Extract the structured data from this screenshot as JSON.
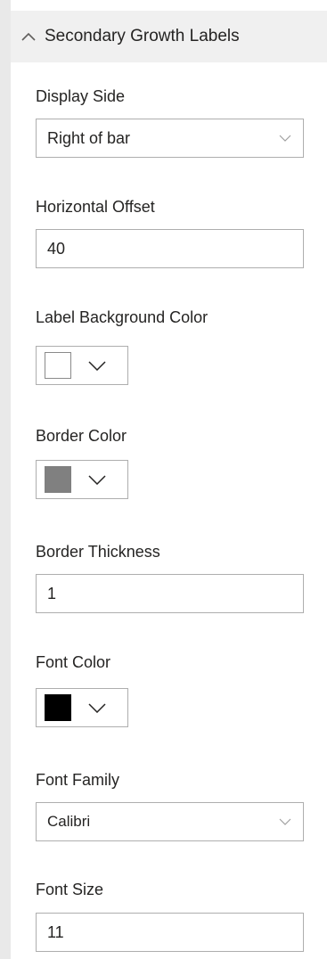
{
  "section": {
    "title": "Secondary Growth Labels",
    "collapse_icon": "chevron-up-icon"
  },
  "fields": {
    "display_side": {
      "label": "Display Side",
      "value": "Right of bar",
      "icon": "chevron-down-icon"
    },
    "horizontal_offset": {
      "label": "Horizontal Offset",
      "value": "40"
    },
    "label_background_color": {
      "label": "Label Background Color",
      "color": "#ffffff",
      "icon": "chevron-down-icon"
    },
    "border_color": {
      "label": "Border Color",
      "color": "#808080",
      "icon": "chevron-down-icon"
    },
    "border_thickness": {
      "label": "Border Thickness",
      "value": "1"
    },
    "font_color": {
      "label": "Font Color",
      "color": "#000000",
      "icon": "chevron-down-icon"
    },
    "font_family": {
      "label": "Font Family",
      "value": "Calibri",
      "icon": "chevron-down-icon"
    },
    "font_size": {
      "label": "Font Size",
      "value": "11"
    }
  }
}
